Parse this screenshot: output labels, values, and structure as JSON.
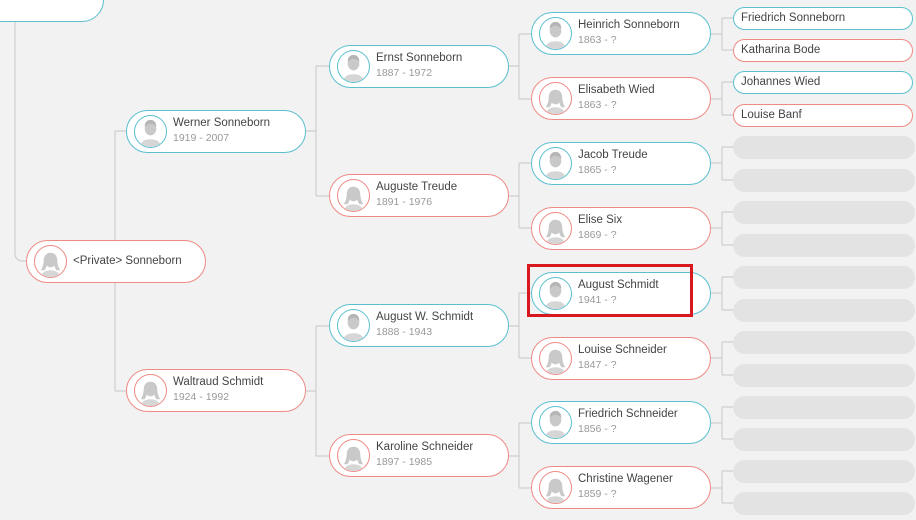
{
  "tree": {
    "root": {
      "name": "<Private> Sonneborn"
    },
    "parents": [
      {
        "name": "Werner Sonneborn",
        "years": "1919 - 2007"
      },
      {
        "name": "Waltraud Schmidt",
        "years": "1924 - 1992"
      }
    ],
    "grandparents": [
      {
        "name": "Ernst Sonneborn",
        "years": "1887 - 1972"
      },
      {
        "name": "Auguste Treude",
        "years": "1891 - 1976"
      },
      {
        "name": "August W. Schmidt",
        "years": "1888 - 1943"
      },
      {
        "name": "Karoline Schneider",
        "years": "1897 - 1985"
      }
    ],
    "great_grandparents": [
      {
        "name": "Heinrich Sonneborn",
        "years": "1863 - ?"
      },
      {
        "name": "Elisabeth Wied",
        "years": "1863 - ?"
      },
      {
        "name": "Jacob Treude",
        "years": "1865 - ?"
      },
      {
        "name": "Elise Six",
        "years": "1869 - ?"
      },
      {
        "name": "August Schmidt",
        "years": "1941 - ?"
      },
      {
        "name": "Louise Schneider",
        "years": "1847 - ?"
      },
      {
        "name": "Friedrich Schneider",
        "years": "1856 - ?"
      },
      {
        "name": "Christine Wagener",
        "years": "1859 - ?"
      }
    ],
    "gen5": [
      {
        "name": "Friedrich Sonneborn"
      },
      {
        "name": "Katharina Bode"
      },
      {
        "name": "Johannes Wied"
      },
      {
        "name": "Louise Banf"
      }
    ]
  },
  "colors": {
    "male": "#5bbfd0",
    "female": "#ee8a84",
    "highlight": "#d9171f"
  },
  "icons": {
    "male": "male-avatar-icon",
    "female": "female-avatar-icon"
  }
}
